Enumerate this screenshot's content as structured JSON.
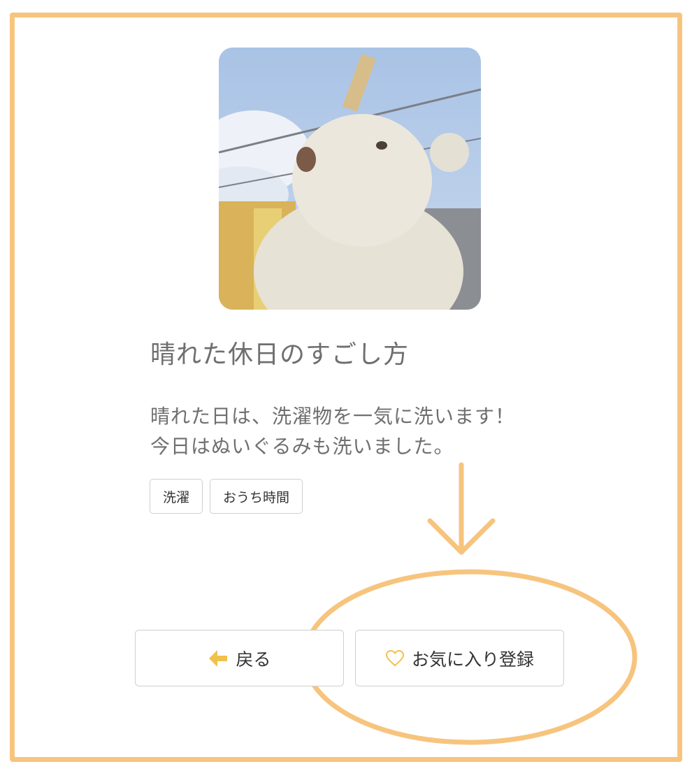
{
  "post": {
    "title": "晴れた休日のすごし方",
    "description_line1": "晴れた日は、洗濯物を一気に洗います！",
    "description_line2": "今日はぬいぐるみも洗いました。",
    "tags": [
      "洗濯",
      "おうち時間"
    ]
  },
  "image": {
    "icon": "teddy-bear-photo"
  },
  "actions": {
    "back_label": "戻る",
    "back_icon": "arrow-left-icon",
    "favorite_label": "お気に入り登録",
    "favorite_icon": "heart-outline-icon"
  },
  "colors": {
    "frame": "#f7c47e",
    "annotation": "#f7c47e",
    "accent_icon": "#f0c24b",
    "text": "#6f6f6f"
  }
}
